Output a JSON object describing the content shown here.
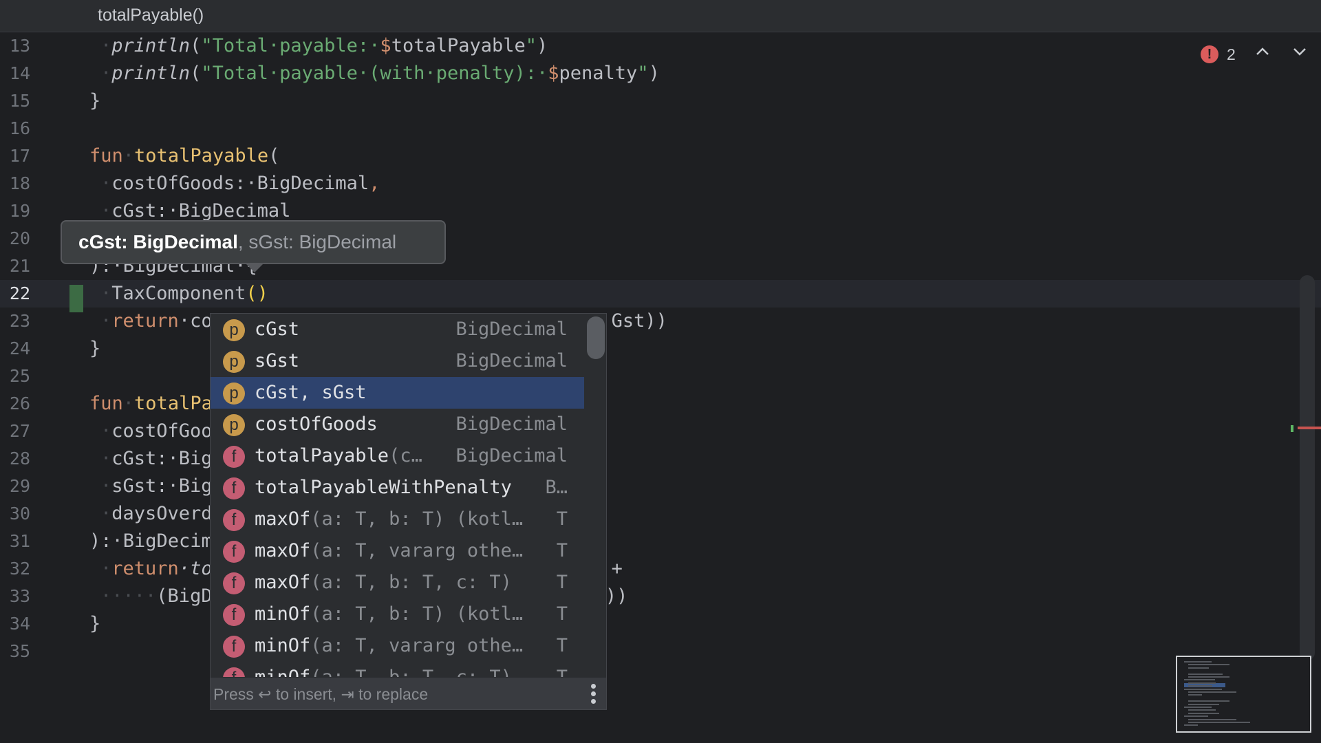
{
  "breadcrumb": {
    "title": "totalPayable()"
  },
  "errors": {
    "count": "2",
    "icon": "error-icon"
  },
  "colors": {
    "accent": "#2e436e",
    "error": "#db5c5c",
    "keyword": "#cf8e6d",
    "string": "#6aab73"
  },
  "code_lines": [
    {
      "num": "13",
      "tokens": [
        [
          "ws",
          "·"
        ],
        [
          "call",
          "println"
        ],
        [
          "p",
          "("
        ],
        [
          "str",
          "\"Total·payable:·"
        ],
        [
          "tmpl",
          "$"
        ],
        [
          "p",
          "totalPayable"
        ],
        [
          "str",
          "\""
        ],
        [
          "p",
          ")"
        ]
      ]
    },
    {
      "num": "14",
      "tokens": [
        [
          "ws",
          "·"
        ],
        [
          "call",
          "println"
        ],
        [
          "p",
          "("
        ],
        [
          "str",
          "\"Total·payable·(with·penalty):·"
        ],
        [
          "tmpl",
          "$"
        ],
        [
          "p",
          "penalty"
        ],
        [
          "str",
          "\""
        ],
        [
          "p",
          ")"
        ]
      ]
    },
    {
      "num": "15",
      "tokens": [
        [
          "p",
          "}"
        ]
      ],
      "indent": -1
    },
    {
      "num": "16",
      "tokens": []
    },
    {
      "num": "17",
      "tokens": [
        [
          "kw",
          "fun"
        ],
        [
          "ws",
          "·"
        ],
        [
          "fnd",
          "totalPayable"
        ],
        [
          "p",
          "("
        ]
      ],
      "indent": -1
    },
    {
      "num": "18",
      "tokens": [
        [
          "ws",
          "·"
        ],
        [
          "p",
          "costOfGoods:·BigDecimal"
        ],
        [
          "kw",
          ","
        ]
      ]
    },
    {
      "num": "19",
      "tokens": [
        [
          "ws",
          "·"
        ],
        [
          "p",
          "cGst:·BigDecimal"
        ]
      ]
    },
    {
      "num": "20",
      "tokens": []
    },
    {
      "num": "21",
      "tokens": [
        [
          "p",
          "):·BigDecimal·{"
        ]
      ],
      "indent": -1
    },
    {
      "num": "22",
      "tokens": [
        [
          "ws",
          "·"
        ],
        [
          "p",
          "TaxComponent"
        ],
        [
          "paren",
          "()"
        ]
      ],
      "current": true
    },
    {
      "num": "23",
      "tokens": [
        [
          "ws",
          "·"
        ],
        [
          "kw",
          "return"
        ],
        [
          "p",
          "·co"
        ],
        [
          "gap",
          ""
        ],
        [
          "p",
          "Gst))"
        ]
      ]
    },
    {
      "num": "24",
      "tokens": [
        [
          "p",
          "}"
        ]
      ],
      "indent": -1
    },
    {
      "num": "25",
      "tokens": []
    },
    {
      "num": "26",
      "tokens": [
        [
          "kw",
          "fun"
        ],
        [
          "ws",
          "·"
        ],
        [
          "fnd",
          "totalPa"
        ]
      ],
      "indent": -1
    },
    {
      "num": "27",
      "tokens": [
        [
          "ws",
          "·"
        ],
        [
          "p",
          "costOfGoo"
        ]
      ]
    },
    {
      "num": "28",
      "tokens": [
        [
          "ws",
          "·"
        ],
        [
          "p",
          "cGst:·Big"
        ]
      ]
    },
    {
      "num": "29",
      "tokens": [
        [
          "ws",
          "·"
        ],
        [
          "p",
          "sGst:·Big"
        ]
      ]
    },
    {
      "num": "30",
      "tokens": [
        [
          "ws",
          "·"
        ],
        [
          "p",
          "daysOverd"
        ]
      ]
    },
    {
      "num": "31",
      "tokens": [
        [
          "p",
          "):·BigDecim"
        ]
      ],
      "indent": -1
    },
    {
      "num": "32",
      "tokens": [
        [
          "ws",
          "·"
        ],
        [
          "kw",
          "return"
        ],
        [
          "call",
          "·to"
        ],
        [
          "gap",
          ""
        ],
        [
          "p",
          "+"
        ]
      ]
    },
    {
      "num": "33",
      "tokens": [
        [
          "ws",
          "·"
        ],
        [
          "ws",
          "····"
        ],
        [
          "p",
          "(BigD"
        ],
        [
          "gap",
          ""
        ],
        [
          "p",
          "(daysOverdue)))"
        ]
      ]
    },
    {
      "num": "34",
      "tokens": [
        [
          "p",
          "}"
        ]
      ],
      "indent": -1
    },
    {
      "num": "35",
      "tokens": []
    }
  ],
  "tooltip": {
    "current_param": "cGst: BigDecimal",
    "rest": ", sGst: BigDecimal"
  },
  "completion": {
    "items": [
      {
        "kind": "p",
        "name": "cGst",
        "params": "",
        "type": "BigDecimal"
      },
      {
        "kind": "p",
        "name": "sGst",
        "params": "",
        "type": "BigDecimal"
      },
      {
        "kind": "p",
        "name": "cGst, sGst",
        "params": "",
        "type": "",
        "selected": true
      },
      {
        "kind": "p",
        "name": "costOfGoods",
        "params": "",
        "type": "BigDecimal"
      },
      {
        "kind": "f",
        "name": "totalPayable",
        "params": "(c…",
        "type": "BigDecimal"
      },
      {
        "kind": "f",
        "name": "totalPayableWithPenalty",
        "params": "",
        "type": "B…"
      },
      {
        "kind": "f",
        "name": "maxOf",
        "params": "(a: T, b: T) (kotl…",
        "type": "T"
      },
      {
        "kind": "f",
        "name": "maxOf",
        "params": "(a: T, vararg othe…",
        "type": "T"
      },
      {
        "kind": "f",
        "name": "maxOf",
        "params": "(a: T, b: T, c: T)",
        "type": "T"
      },
      {
        "kind": "f",
        "name": "minOf",
        "params": "(a: T, b: T) (kotl…",
        "type": "T"
      },
      {
        "kind": "f",
        "name": "minOf",
        "params": "(a: T, vararg othe…",
        "type": "T"
      },
      {
        "kind": "f",
        "name": "minOf",
        "params": "(a: T, b: T, c: T)",
        "type": "T"
      }
    ],
    "footer_hint": "Press ↩ to insert, ⇥ to replace"
  }
}
